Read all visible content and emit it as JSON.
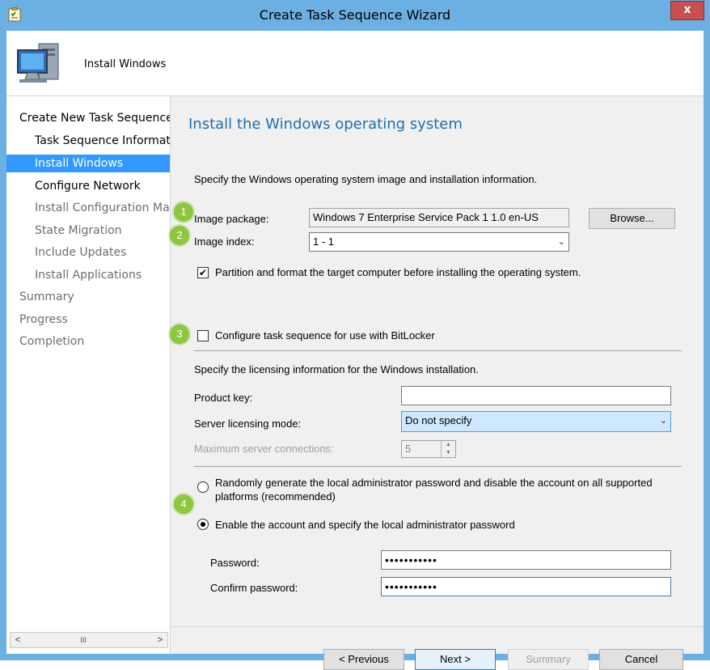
{
  "window": {
    "title": "Create Task Sequence Wizard",
    "close_label": "x"
  },
  "header": {
    "title": "Install Windows"
  },
  "nav": {
    "items": [
      {
        "label": "Create New Task Sequence"
      },
      {
        "label": "Task Sequence Information"
      },
      {
        "label": "Install Windows"
      },
      {
        "label": "Configure Network"
      },
      {
        "label": "Install Configuration Manager"
      },
      {
        "label": "State Migration"
      },
      {
        "label": "Include Updates"
      },
      {
        "label": "Install Applications"
      },
      {
        "label": "Summary"
      },
      {
        "label": "Progress"
      },
      {
        "label": "Completion"
      }
    ],
    "scroll_left": "<",
    "scroll_thumb": "III",
    "scroll_right": ">"
  },
  "main": {
    "title": "Install the Windows operating system",
    "intro": "Specify the Windows operating system image and installation information.",
    "image_package_label": "Image package:",
    "image_package_value": "Windows 7 Enterprise Service Pack 1 1.0 en-US",
    "browse_label": "Browse...",
    "image_index_label": "Image index:",
    "image_index_value": "1 - 1",
    "partition_label": "Partition and format the target computer before installing the operating system.",
    "partition_checked": true,
    "bitlocker_label": "Configure task sequence for use with BitLocker",
    "bitlocker_checked": false,
    "licensing_intro": "Specify the licensing information for the Windows installation.",
    "product_key_label": "Product key:",
    "product_key_value": "",
    "server_licensing_label": "Server licensing mode:",
    "server_licensing_value": "Do not specify",
    "max_connections_label": "Maximum server connections:",
    "max_connections_value": "5",
    "radio_random_label_line1": "Randomly generate the local administrator password and disable the account on all supported",
    "radio_random_label_line2": "platforms (recommended)",
    "radio_enable_label": "Enable the account and specify the local administrator password",
    "selected_radio": "enable",
    "password_label": "Password:",
    "password_value": "•••••••••••",
    "confirm_password_label": "Confirm password:",
    "confirm_password_value": "•••••••••••"
  },
  "badges": [
    "1",
    "2",
    "3",
    "4"
  ],
  "footer": {
    "previous_label": "< Previous",
    "next_label": "Next >",
    "summary_label": "Summary",
    "cancel_label": "Cancel"
  },
  "colors": {
    "titlebar": "#6cb0e3",
    "close_button": "#c75050",
    "nav_selected": "#3399ff",
    "page_title": "#1e6fb0",
    "badge": "#8dc63f"
  }
}
